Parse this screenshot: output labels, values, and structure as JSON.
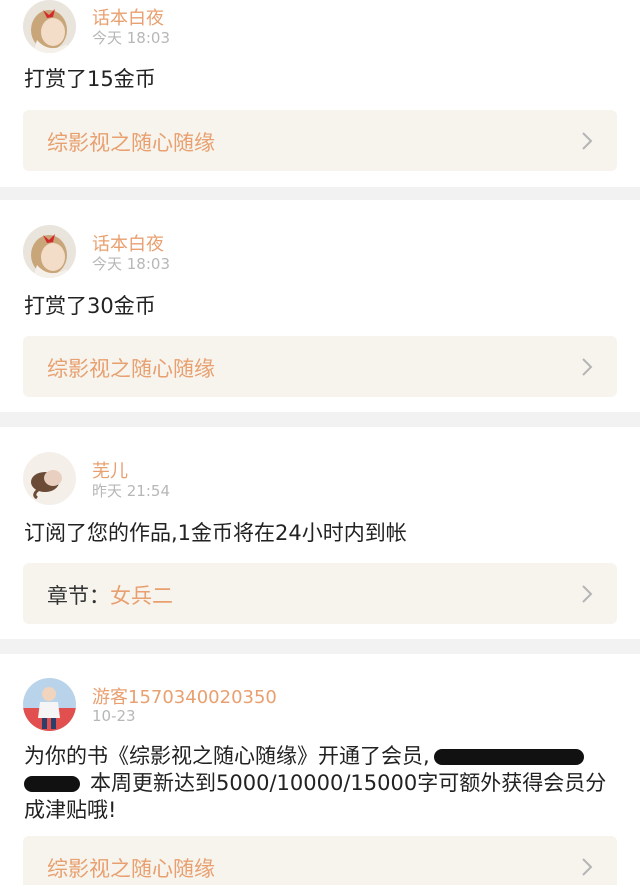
{
  "colors": {
    "accent": "#e8a070",
    "link_bg": "#f6f4ed",
    "divider": "#f2f2f2",
    "timestamp": "#b7b7b7"
  },
  "notifications": [
    {
      "avatar": "girl-red-bow",
      "username": "话本白夜",
      "time": "今天 18:03",
      "message": "打赏了15金币",
      "link": {
        "prefix": "",
        "text": "综影视之随心随缘"
      }
    },
    {
      "avatar": "girl-red-bow",
      "username": "话本白夜",
      "time": "今天 18:03",
      "message": "打赏了30金币",
      "link": {
        "prefix": "",
        "text": "综影视之随心随缘"
      }
    },
    {
      "avatar": "girl-hair",
      "username": "芜儿",
      "time": "昨天 21:54",
      "message": "订阅了您的作品,1金币将在24小时内到帐",
      "link": {
        "prefix": "章节：",
        "text": "女兵二"
      }
    },
    {
      "avatar": "child-red-shirt",
      "username": "游客1570340020350",
      "time": "10-23",
      "message_a": "为你的书《综影视之随心随缘》开通了会员,",
      "message_b": "本周更新达到5000/10000/15000字可额外获得会员分成津贴哦!",
      "link": {
        "prefix": "",
        "text": "综影视之随心随缘"
      }
    }
  ]
}
